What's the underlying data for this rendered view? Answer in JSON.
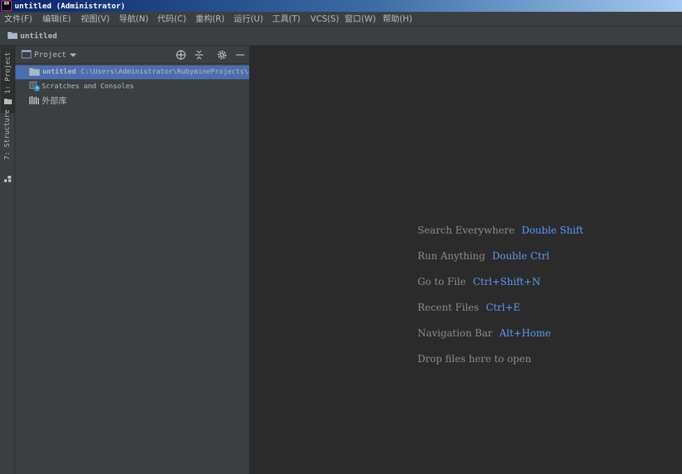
{
  "window": {
    "app_icon_text": "RM",
    "title": "untitled (Administrator)"
  },
  "menu": [
    {
      "label": "文件(F)"
    },
    {
      "label": "编辑(E)"
    },
    {
      "label": "视图(V)"
    },
    {
      "label": "导航(N)"
    },
    {
      "label": "代码(C)"
    },
    {
      "label": "重构(R)"
    },
    {
      "label": "运行(U)"
    },
    {
      "label": "工具(T)"
    },
    {
      "label": "VCS(S)"
    },
    {
      "label": "窗口(W)"
    },
    {
      "label": "帮助(H)"
    }
  ],
  "navbar": {
    "project_name": "untitled"
  },
  "side_tabs": {
    "project": "1: Project",
    "structure": "7: Structure"
  },
  "project_panel": {
    "view_label": "Project",
    "tree": [
      {
        "name": "untitled",
        "path": "C:\\Users\\Administrator\\RubymineProjects\\untitled",
        "icon": "folder-icon",
        "selected": true
      },
      {
        "name": "Scratches and Consoles",
        "icon": "scratches-icon"
      },
      {
        "name": "外部库",
        "icon": "library-icon"
      }
    ]
  },
  "editor_hints": [
    {
      "action": "Search Everywhere",
      "shortcut": "Double Shift"
    },
    {
      "action": "Run Anything",
      "shortcut": "Double Ctrl"
    },
    {
      "action": "Go to File",
      "shortcut": "Ctrl+Shift+N"
    },
    {
      "action": "Recent Files",
      "shortcut": "Ctrl+E"
    },
    {
      "action": "Navigation Bar",
      "shortcut": "Alt+Home"
    },
    {
      "action": "Drop files here to open",
      "shortcut": ""
    }
  ],
  "colors": {
    "background": "#2b2b2b",
    "panel": "#3c3f41",
    "selection": "#4b6eaf",
    "shortcut": "#589df6",
    "text": "#bbbbbb"
  }
}
